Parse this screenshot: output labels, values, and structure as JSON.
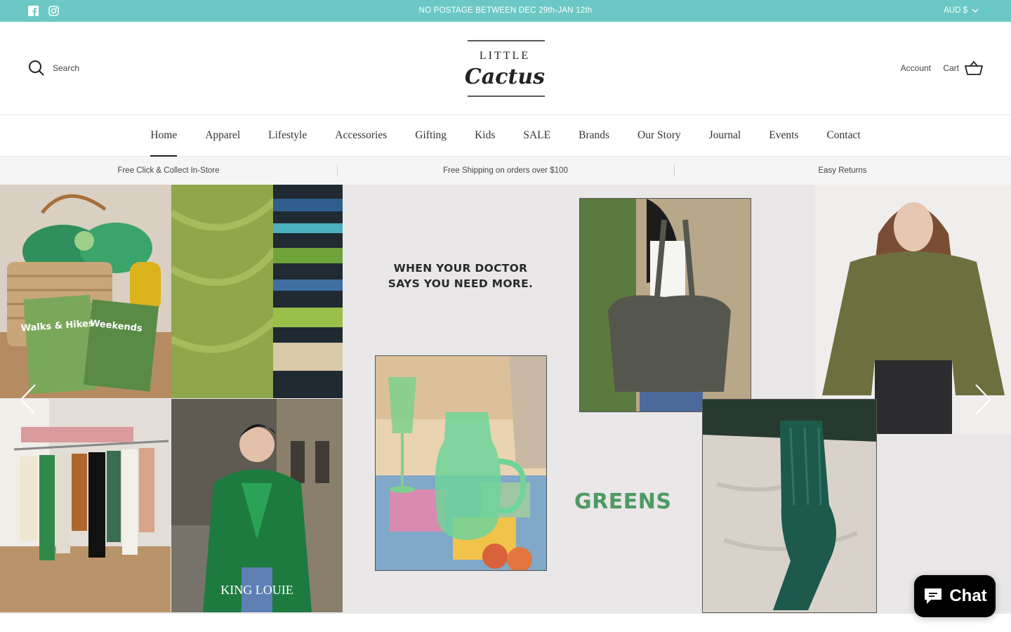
{
  "announcement": {
    "message": "NO POSTAGE BETWEEN DEC 29th-JAN 12th",
    "currency": "AUD $",
    "social": [
      "facebook-icon",
      "instagram-icon"
    ]
  },
  "header": {
    "search_label": "Search",
    "logo_top": "LITTLE",
    "logo_bottom": "Cactus",
    "account_label": "Account",
    "cart_label": "Cart"
  },
  "nav": {
    "items": [
      "Home",
      "Apparel",
      "Lifestyle",
      "Accessories",
      "Gifting",
      "Kids",
      "SALE",
      "Brands",
      "Our Story",
      "Journal",
      "Events",
      "Contact"
    ],
    "active": "Home"
  },
  "benefits": [
    "Free Click & Collect In-Store",
    "Free Shipping on orders over $100",
    "Easy Returns"
  ],
  "hero": {
    "headline_line1": "WHEN YOUR DOCTOR",
    "headline_line2": "SAYS YOU NEED MORE.",
    "accent": "GREENS",
    "book_title_1": "Walks & Hikes",
    "book_title_2": "Weekends",
    "brand_caption": "KING LOUIE"
  },
  "chat": {
    "label": "Chat"
  },
  "colors": {
    "announcement_bg": "#6cc8c4",
    "greens_text": "#4f9a63",
    "chat_bg": "#000000"
  }
}
